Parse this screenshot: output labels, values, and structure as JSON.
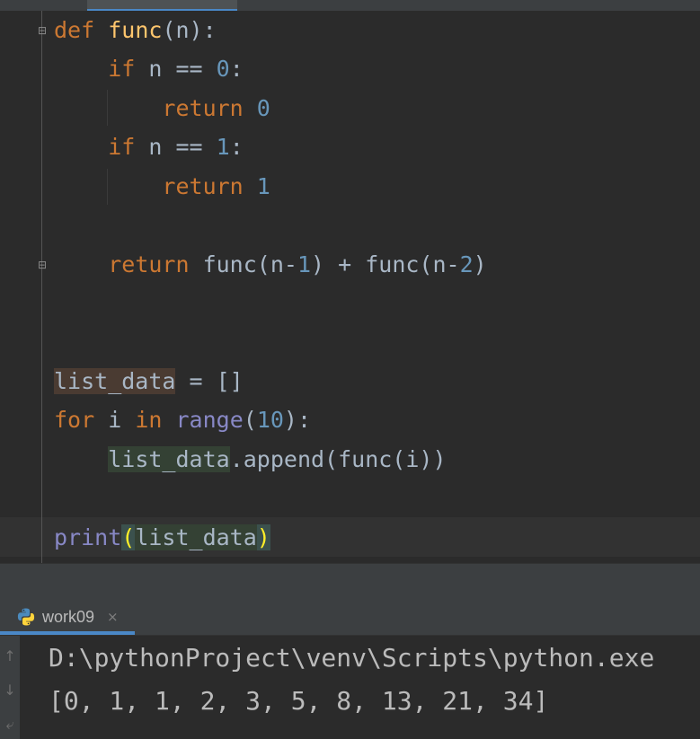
{
  "editor": {
    "lines": [
      {
        "tokens": [
          {
            "t": "def",
            "c": "kw"
          },
          {
            "t": " "
          },
          {
            "t": "func",
            "c": "fn"
          },
          {
            "t": "(n):"
          }
        ]
      },
      {
        "tokens": [
          {
            "t": "    "
          },
          {
            "t": "if",
            "c": "kw"
          },
          {
            "t": " n == "
          },
          {
            "t": "0",
            "c": "num"
          },
          {
            "t": ":"
          }
        ]
      },
      {
        "tokens": [
          {
            "t": "        "
          },
          {
            "t": "return",
            "c": "kw"
          },
          {
            "t": " "
          },
          {
            "t": "0",
            "c": "num"
          }
        ]
      },
      {
        "tokens": [
          {
            "t": "    "
          },
          {
            "t": "if",
            "c": "kw"
          },
          {
            "t": " n == "
          },
          {
            "t": "1",
            "c": "num"
          },
          {
            "t": ":"
          }
        ]
      },
      {
        "tokens": [
          {
            "t": "        "
          },
          {
            "t": "return",
            "c": "kw"
          },
          {
            "t": " "
          },
          {
            "t": "1",
            "c": "num"
          }
        ]
      },
      {
        "tokens": []
      },
      {
        "tokens": [
          {
            "t": "    "
          },
          {
            "t": "return",
            "c": "kw"
          },
          {
            "t": " func(n-"
          },
          {
            "t": "1",
            "c": "num"
          },
          {
            "t": ") + func(n-"
          },
          {
            "t": "2",
            "c": "num"
          },
          {
            "t": ")"
          }
        ]
      },
      {
        "tokens": []
      },
      {
        "tokens": []
      },
      {
        "tokens": [
          {
            "t": "list_data",
            "c": "hl-brown"
          },
          {
            "t": " = []"
          }
        ]
      },
      {
        "tokens": [
          {
            "t": "for",
            "c": "kw"
          },
          {
            "t": " i "
          },
          {
            "t": "in",
            "c": "kw"
          },
          {
            "t": " "
          },
          {
            "t": "range",
            "c": "builtin"
          },
          {
            "t": "("
          },
          {
            "t": "10",
            "c": "num"
          },
          {
            "t": "):"
          }
        ]
      },
      {
        "tokens": [
          {
            "t": "    "
          },
          {
            "t": "list_data",
            "c": "hl-green"
          },
          {
            "t": ".append(func(i))"
          }
        ]
      },
      {
        "tokens": []
      },
      {
        "tokens": [
          {
            "t": "print",
            "c": "builtin"
          },
          {
            "t": "(",
            "c": "hl-paren"
          },
          {
            "t": "list_data",
            "c": "hl-green"
          },
          {
            "t": ")",
            "c": "hl-paren"
          }
        ]
      }
    ]
  },
  "run_panel": {
    "tab_label": "work09",
    "tab_close": "×",
    "console_lines": [
      "D:\\pythonProject\\venv\\Scripts\\python.exe",
      "[0, 1, 1, 2, 3, 5, 8, 13, 21, 34]"
    ],
    "toolbar_icons": [
      "arrow-up-icon",
      "arrow-down-icon",
      "soft-wrap-icon"
    ]
  },
  "colors": {
    "keyword": "#cc7832",
    "function": "#ffc66d",
    "number": "#6897bb",
    "builtin": "#8888c6",
    "text": "#a9b7c6",
    "accent": "#4a88c7"
  }
}
